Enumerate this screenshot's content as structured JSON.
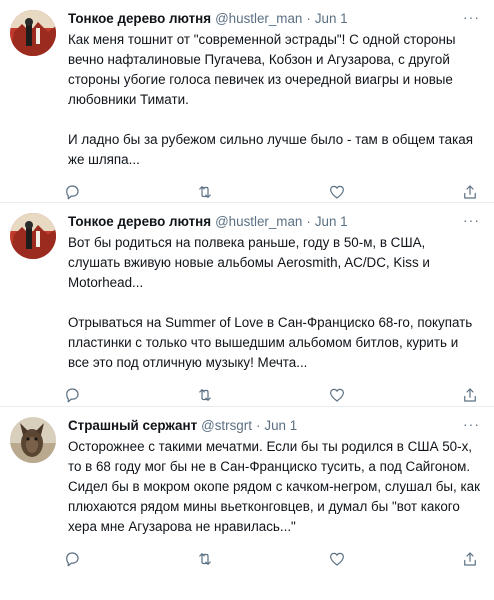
{
  "tweets": [
    {
      "name": "Тонкое дерево лютня",
      "handle": "@hustler_man",
      "separator": "·",
      "date": "Jun 1",
      "more": "···",
      "text": "Как меня тошнит от \"современной эстрады\"! С одной стороны вечно нафталиновые Пугачева, Кобзон и Агузарова, с другой стороны убогие голоса певичек из очередной виагры и новые любовники Тимати.\n\nИ ладно бы за рубежом сильно лучше было - там в общем такая же шляпа..."
    },
    {
      "name": "Тонкое дерево лютня",
      "handle": "@hustler_man",
      "separator": "·",
      "date": "Jun 1",
      "more": "···",
      "text": "Вот бы родиться на полвека раньше, году в 50-м, в США, слушать вживую новые альбомы Aerosmith, AC/DC, Kiss и Motorhead...\n\nОтрываться на Summer of Love в Сан-Франциско 68-го, покупать пластинки с только что вышедшим альбомом битлов, курить и все это под отличную музыку! Мечта..."
    },
    {
      "name": "Страшный сержант",
      "handle": "@strsgrt",
      "separator": "·",
      "date": "Jun 1",
      "more": "···",
      "text": "Осторожнее с такими мечатми. Если бы ты родился в США 50-х, то в 68 году мог бы не в Сан-Франциско тусить, а под Сайгоном. Сидел бы в мокром окопе рядом с качком-негром, слушал бы, как плюхаются рядом мины вьетконговцев, и думал бы \"вот какого хера мне Агузарова не нравилась...\""
    }
  ],
  "icons": {
    "reply": "reply-icon",
    "retweet": "retweet-icon",
    "like": "heart-icon",
    "share": "share-icon",
    "more": "more-icon"
  },
  "colors": {
    "text": "#0f1419",
    "muted": "#5b7083",
    "divider": "#e6ecf0",
    "background": "#ffffff"
  }
}
